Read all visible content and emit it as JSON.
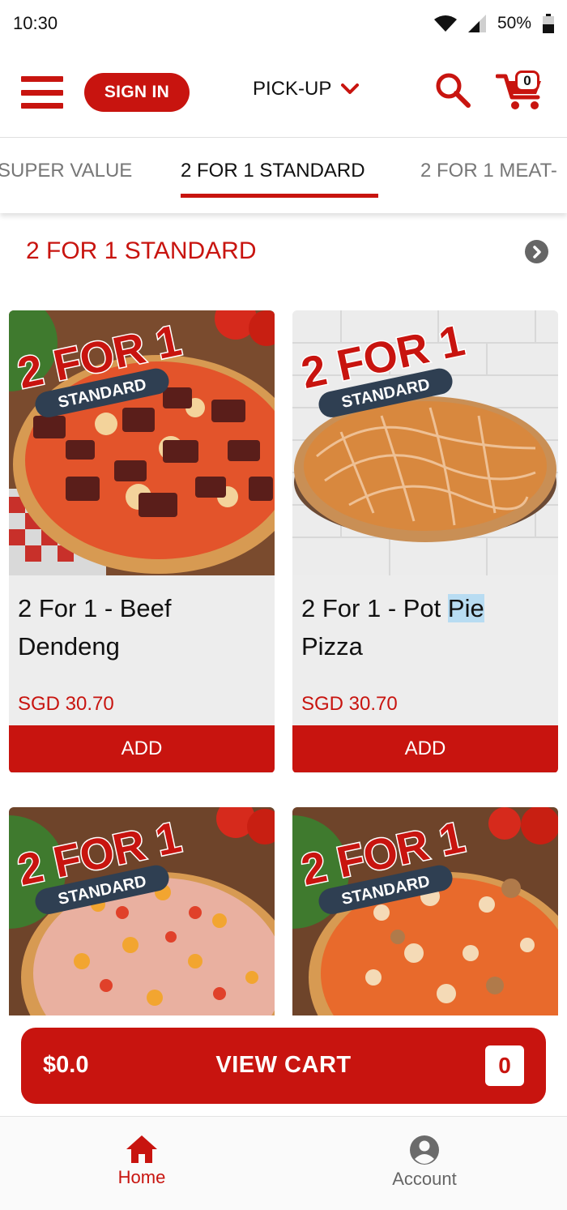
{
  "status_bar": {
    "time": "10:30",
    "battery": "50%"
  },
  "header": {
    "sign_in_label": "SIGN IN",
    "order_mode": "PICK-UP",
    "cart_count": "0"
  },
  "tabs": [
    {
      "label": "SUPER VALUE"
    },
    {
      "label": "2 FOR 1 STANDARD",
      "active": true
    },
    {
      "label": "2 FOR 1 MEAT-"
    }
  ],
  "section": {
    "title": "2 FOR 1 STANDARD"
  },
  "products": [
    {
      "name_line1": "2 For 1 - Beef",
      "name_line2": "Dendeng",
      "price": "SGD 30.70",
      "add_label": "ADD",
      "badge_top": "2 FOR 1",
      "badge_bottom": "STANDARD"
    },
    {
      "name_line1_pre": "2 For 1 - Pot ",
      "name_line1_hl": "Pie",
      "name_line2": "Pizza",
      "price": "SGD 30.70",
      "add_label": "ADD",
      "badge_top": "2 FOR 1",
      "badge_bottom": "STANDARD"
    },
    {
      "badge_top": "2 FOR 1",
      "badge_bottom": "STANDARD"
    },
    {
      "badge_top": "2 FOR 1",
      "badge_bottom": "STANDARD"
    }
  ],
  "view_cart": {
    "total": "$0.0",
    "label": "VIEW CART",
    "count": "0"
  },
  "bottom_nav": [
    {
      "label": "Home",
      "active": true,
      "icon": "home-icon"
    },
    {
      "label": "Account",
      "active": false,
      "icon": "account-icon"
    }
  ],
  "colors": {
    "brand_red": "#c8140f",
    "card_bg": "#ededed",
    "muted_text": "#777777"
  }
}
